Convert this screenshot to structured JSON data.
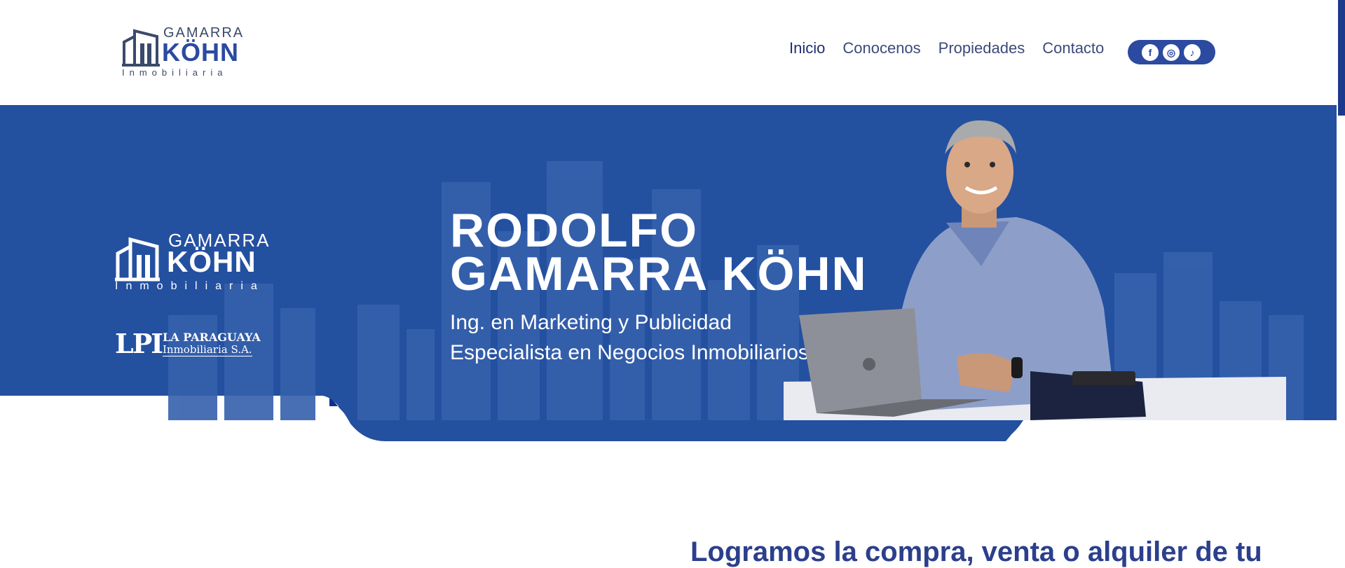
{
  "header": {
    "logo": {
      "line1": "GAMARRA",
      "line2": "KÖHN",
      "line3": "Inmobiliaria"
    },
    "nav": [
      {
        "label": "Inicio"
      },
      {
        "label": "Conocenos"
      },
      {
        "label": "Propiedades"
      },
      {
        "label": "Contacto"
      }
    ],
    "social": [
      {
        "icon": "facebook-icon",
        "glyph": "f"
      },
      {
        "icon": "instagram-icon",
        "glyph": "◎"
      },
      {
        "icon": "tiktok-icon",
        "glyph": "♪"
      }
    ]
  },
  "hero": {
    "logo": {
      "line1": "GAMARRA",
      "line2": "KÖHN",
      "line3": "Inmobiliaria"
    },
    "partner": {
      "mark": "LPI",
      "line1": "LA PARAGUAYA",
      "line2": "Inmobiliaria S.A."
    },
    "title_line1": "RODOLFO",
    "title_line2": "GAMARRA KÖHN",
    "subtitle_line1": "Ing. en Marketing y Publicidad",
    "subtitle_line2": "Especialista en Negocios Inmobiliarios"
  },
  "section": {
    "heading": "Logramos la compra, venta o alquiler de tu"
  },
  "colors": {
    "brand_blue": "#2b4aa0",
    "hero_blue": "#2450a0",
    "dark_blue": "#0e2f8a",
    "nav_text": "#3b4a7a"
  }
}
